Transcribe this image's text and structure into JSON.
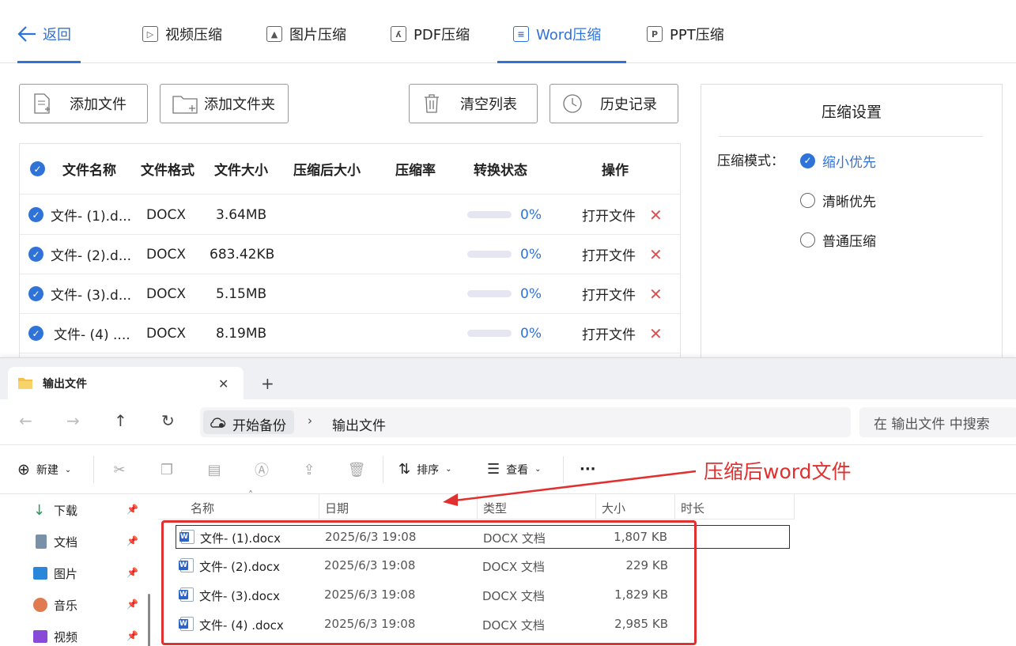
{
  "topbar": {
    "back_label": "返回",
    "tabs": [
      {
        "label": "视频压缩",
        "icon": "play-icon"
      },
      {
        "label": "图片压缩",
        "icon": "image-icon"
      },
      {
        "label": "PDF压缩",
        "icon": "pdf-icon"
      },
      {
        "label": "Word压缩",
        "icon": "doc-icon",
        "active": true
      },
      {
        "label": "PPT压缩",
        "icon": "ppt-icon"
      }
    ]
  },
  "actions": {
    "add_file": "添加文件",
    "add_folder": "添加文件夹",
    "clear_list": "清空列表",
    "history": "历史记录"
  },
  "file_table": {
    "headers": {
      "name": "文件名称",
      "format": "文件格式",
      "size": "文件大小",
      "compressed_size": "压缩后大小",
      "ratio": "压缩率",
      "status": "转换状态",
      "ops": "操作"
    },
    "rows": [
      {
        "name": "文件- (1).d...",
        "format": "DOCX",
        "size": "3.64MB",
        "progress": "0%",
        "open": "打开文件"
      },
      {
        "name": "文件- (2).d...",
        "format": "DOCX",
        "size": "683.42KB",
        "progress": "0%",
        "open": "打开文件"
      },
      {
        "name": "文件- (3).d...",
        "format": "DOCX",
        "size": "5.15MB",
        "progress": "0%",
        "open": "打开文件"
      },
      {
        "name": "文件- (4) ....",
        "format": "DOCX",
        "size": "8.19MB",
        "progress": "0%",
        "open": "打开文件"
      }
    ]
  },
  "settings": {
    "title": "压缩设置",
    "mode_label": "压缩模式：",
    "options": [
      {
        "label": "缩小优先",
        "selected": true
      },
      {
        "label": "清晰优先",
        "selected": false
      },
      {
        "label": "普通压缩",
        "selected": false
      }
    ]
  },
  "explorer": {
    "tab_title": "输出文件",
    "breadcrumb_root": "开始备份",
    "breadcrumb_current": "输出文件",
    "search_placeholder": "在 输出文件 中搜索",
    "toolbar": {
      "new": "新建",
      "sort": "排序",
      "view": "查看",
      "more": "···"
    },
    "sidebar": [
      {
        "label": "下载",
        "icon": "download-icon"
      },
      {
        "label": "文档",
        "icon": "document-icon"
      },
      {
        "label": "图片",
        "icon": "pictures-icon"
      },
      {
        "label": "音乐",
        "icon": "music-icon"
      },
      {
        "label": "视频",
        "icon": "video-icon"
      }
    ],
    "columns": {
      "name": "名称",
      "date": "日期",
      "type": "类型",
      "size": "大小",
      "duration": "时长"
    },
    "files": [
      {
        "name": "文件- (1).docx",
        "date": "2025/6/3 19:08",
        "type": "DOCX 文档",
        "size": "1,807 KB"
      },
      {
        "name": "文件- (2).docx",
        "date": "2025/6/3 19:08",
        "type": "DOCX 文档",
        "size": "229 KB"
      },
      {
        "name": "文件- (3).docx",
        "date": "2025/6/3 19:08",
        "type": "DOCX 文档",
        "size": "1,829 KB"
      },
      {
        "name": "文件- (4) .docx",
        "date": "2025/6/3 19:08",
        "type": "DOCX 文档",
        "size": "2,985 KB"
      }
    ]
  },
  "annotation": {
    "text": "压缩后word文件",
    "color": "#e0302f"
  },
  "colors": {
    "accent": "#2f73d8",
    "danger": "#e05050"
  }
}
